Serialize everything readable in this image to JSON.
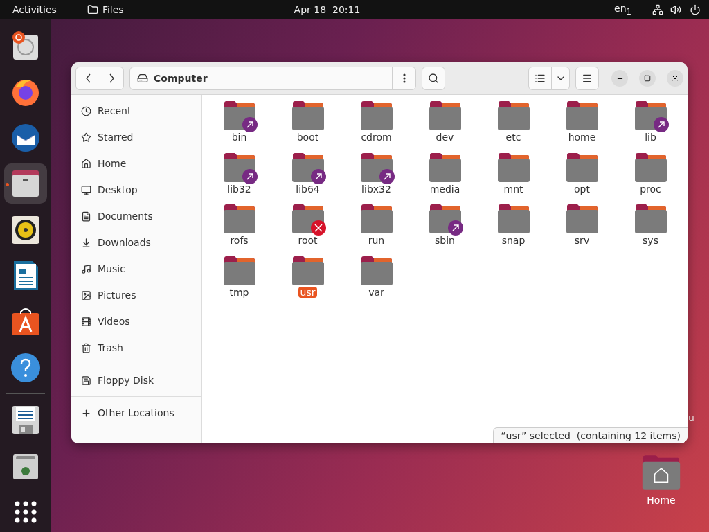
{
  "top_bar": {
    "activities": "Activities",
    "app_menu": "Files",
    "clock": "Apr 18  20:11",
    "input_source": "en$_{1}$"
  },
  "dock": [
    {
      "kind": "analyzer",
      "selected": false
    },
    {
      "kind": "browser",
      "selected": false
    },
    {
      "kind": "mail",
      "selected": false
    },
    {
      "kind": "files",
      "selected": true
    },
    {
      "kind": "music",
      "selected": false
    },
    {
      "kind": "writer",
      "selected": false
    },
    {
      "kind": "store",
      "selected": false
    },
    {
      "kind": "help",
      "selected": false
    },
    {
      "kind": "floppy",
      "selected": false
    },
    {
      "kind": "trash",
      "selected": false
    },
    {
      "kind": "apps",
      "selected": false
    }
  ],
  "window": {
    "location": "Computer",
    "sidebar": [
      {
        "label": "Recent",
        "kind": "recent",
        "selected": false
      },
      {
        "label": "Starred",
        "kind": "starred",
        "selected": false
      },
      {
        "label": "Home",
        "kind": "home",
        "selected": false
      },
      {
        "label": "Desktop",
        "kind": "desktop",
        "selected": false
      },
      {
        "label": "Documents",
        "kind": "documents",
        "selected": false
      },
      {
        "label": "Downloads",
        "kind": "downloads",
        "selected": false
      },
      {
        "label": "Music",
        "kind": "music",
        "selected": false
      },
      {
        "label": "Pictures",
        "kind": "pictures",
        "selected": false
      },
      {
        "label": "Videos",
        "kind": "videos",
        "selected": false
      },
      {
        "label": "Trash",
        "kind": "trash",
        "selected": false
      },
      {
        "label": "Floppy Disk",
        "kind": "floppy",
        "selected": false
      },
      {
        "label": "Other Locations",
        "kind": "other",
        "selected": false
      }
    ],
    "files": [
      {
        "name": "bin",
        "symlink": true,
        "no_access": false,
        "selected": false
      },
      {
        "name": "boot",
        "symlink": false,
        "no_access": false,
        "selected": false
      },
      {
        "name": "cdrom",
        "symlink": false,
        "no_access": false,
        "selected": false
      },
      {
        "name": "dev",
        "symlink": false,
        "no_access": false,
        "selected": false
      },
      {
        "name": "etc",
        "symlink": false,
        "no_access": false,
        "selected": false
      },
      {
        "name": "home",
        "symlink": false,
        "no_access": false,
        "selected": false
      },
      {
        "name": "lib",
        "symlink": true,
        "no_access": false,
        "selected": false
      },
      {
        "name": "lib32",
        "symlink": true,
        "no_access": false,
        "selected": false
      },
      {
        "name": "lib64",
        "symlink": true,
        "no_access": false,
        "selected": false
      },
      {
        "name": "libx32",
        "symlink": true,
        "no_access": false,
        "selected": false
      },
      {
        "name": "media",
        "symlink": false,
        "no_access": false,
        "selected": false
      },
      {
        "name": "mnt",
        "symlink": false,
        "no_access": false,
        "selected": false
      },
      {
        "name": "opt",
        "symlink": false,
        "no_access": false,
        "selected": false
      },
      {
        "name": "proc",
        "symlink": false,
        "no_access": false,
        "selected": false
      },
      {
        "name": "rofs",
        "symlink": false,
        "no_access": false,
        "selected": false
      },
      {
        "name": "root",
        "symlink": false,
        "no_access": true,
        "selected": false
      },
      {
        "name": "run",
        "symlink": false,
        "no_access": false,
        "selected": false
      },
      {
        "name": "sbin",
        "symlink": true,
        "no_access": false,
        "selected": false
      },
      {
        "name": "snap",
        "symlink": false,
        "no_access": false,
        "selected": false
      },
      {
        "name": "srv",
        "symlink": false,
        "no_access": false,
        "selected": false
      },
      {
        "name": "sys",
        "symlink": false,
        "no_access": false,
        "selected": false
      },
      {
        "name": "tmp",
        "symlink": false,
        "no_access": false,
        "selected": false
      },
      {
        "name": "usr",
        "symlink": false,
        "no_access": false,
        "selected": true
      },
      {
        "name": "var",
        "symlink": false,
        "no_access": false,
        "selected": false
      }
    ],
    "status": "“usr” selected  (containing 12 items)"
  },
  "desktop": {
    "hidden_label": "u",
    "icons": [
      {
        "label": "Home"
      }
    ]
  }
}
